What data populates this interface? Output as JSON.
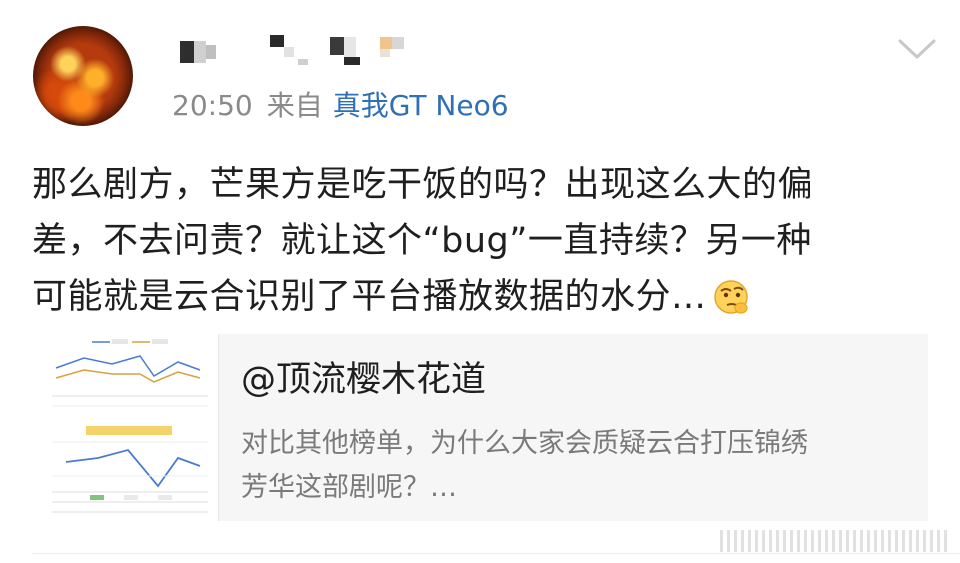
{
  "post": {
    "time": "20:50",
    "from_label": "来自",
    "device": "真我GT Neo6",
    "text_lines": [
      "那么剧方，芒果方是吃干饭的吗？出现这么大的偏",
      "差，不去问责？就让这个“bug”一直持续？另一种",
      "可能就是云合识别了平台播放数据的水分…"
    ]
  },
  "card": {
    "title": "@顶流樱木花道",
    "desc_lines": [
      "对比其他榜单，为什么大家会质疑云合打压锦绣",
      "芳华这部剧呢？…"
    ]
  },
  "icons": {
    "menu": "chevron-down-icon",
    "emoji": "thinking-face-emoji-icon"
  },
  "colors": {
    "link": "#2f6fb6",
    "muted": "#8a8a8a",
    "card_bg": "#f6f6f6"
  }
}
